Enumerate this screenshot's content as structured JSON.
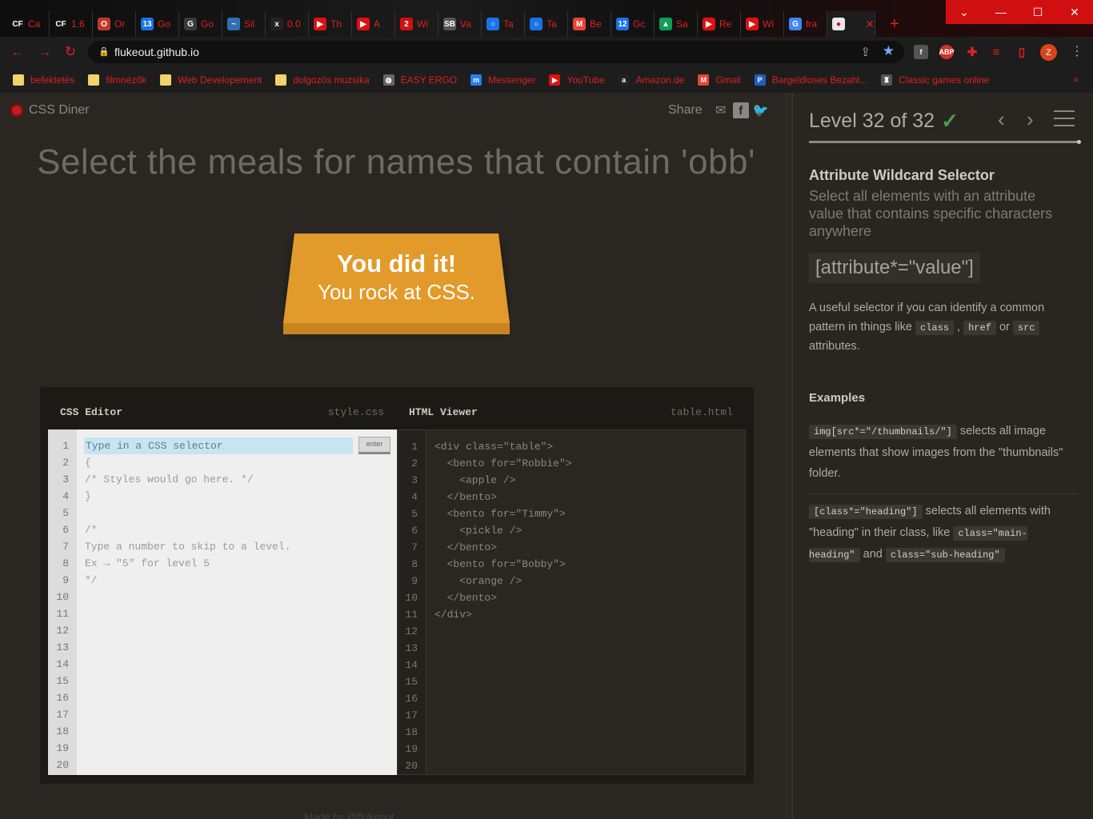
{
  "browser": {
    "tabs": [
      {
        "icon": "CF",
        "title": "Ca",
        "color": "#111111"
      },
      {
        "icon": "CF",
        "title": "1.6",
        "color": "#111111"
      },
      {
        "icon": "O",
        "title": "Or",
        "color": "#c0392b"
      },
      {
        "icon": "13",
        "title": "Go",
        "color": "#1a73e8"
      },
      {
        "icon": "G",
        "title": "Go",
        "color": "#3a3a3a"
      },
      {
        "icon": "~",
        "title": "Sil",
        "color": "#2f6fb3"
      },
      {
        "icon": "x",
        "title": "0.0",
        "color": "#222222"
      },
      {
        "icon": "▶",
        "title": "Th",
        "color": "#e01010"
      },
      {
        "icon": "▶",
        "title": "A ",
        "color": "#e01010"
      },
      {
        "icon": "2",
        "title": "Wi",
        "color": "#d01010"
      },
      {
        "icon": "SB",
        "title": "Va",
        "color": "#555555"
      },
      {
        "icon": "○",
        "title": "Ta",
        "color": "#1a73e8"
      },
      {
        "icon": "○",
        "title": "Ta",
        "color": "#1a73e8"
      },
      {
        "icon": "M",
        "title": "Be",
        "color": "#ea4335"
      },
      {
        "icon": "12",
        "title": "Gc",
        "color": "#1a73e8"
      },
      {
        "icon": "▲",
        "title": "Sa",
        "color": "#0f9d58"
      },
      {
        "icon": "▶",
        "title": "Re",
        "color": "#e01010"
      },
      {
        "icon": "▶",
        "title": "Wi",
        "color": "#e01010"
      },
      {
        "icon": "G",
        "title": "fra",
        "color": "#4285f4"
      },
      {
        "icon": "●",
        "title": "",
        "color": "#e8e8e8",
        "active": true
      }
    ],
    "url": "flukeout.github.io",
    "bookmarks": [
      {
        "label": "befektetés",
        "type": "folder"
      },
      {
        "label": "filmnézők",
        "type": "folder"
      },
      {
        "label": "Web Developement",
        "type": "folder"
      },
      {
        "label": "dolgozós muzsika",
        "type": "folder"
      },
      {
        "label": "EASY ERGO",
        "type": "globe"
      },
      {
        "label": "Messenger",
        "type": "messenger"
      },
      {
        "label": "YouTube",
        "type": "youtube"
      },
      {
        "label": "Amazon.de",
        "type": "amazon"
      },
      {
        "label": "Gmail",
        "type": "gmail"
      },
      {
        "label": "Bargeldloses Bezahl...",
        "type": "paypal"
      },
      {
        "label": "Classic games online",
        "type": "game"
      }
    ],
    "profile_initial": "Z"
  },
  "game": {
    "logo": "CSS Diner",
    "share_label": "Share",
    "instruction": "Select the meals for names that contain 'obb'",
    "win_line1": "You did it!",
    "win_line2": "You rock at CSS.",
    "css_editor": {
      "title": "CSS Editor",
      "file": "style.css",
      "placeholder": "Type in a CSS selector",
      "enter_label": "enter",
      "lines": [
        "",
        "{",
        "/* Styles would go here. */",
        "}",
        "",
        "/*",
        "Type a number to skip to a level.",
        "Ex → \"5\" for level 5",
        "*/"
      ]
    },
    "html_viewer": {
      "title": "HTML Viewer",
      "file": "table.html",
      "lines": [
        "<div class=\"table\">",
        "  <bento for=\"Robbie\">",
        "    <apple />",
        "  </bento>",
        "  <bento for=\"Timmy\">",
        "    <pickle />",
        "  </bento>",
        "  <bento for=\"Bobby\">",
        "    <orange />",
        "  </bento>",
        "</div>"
      ]
    },
    "line_count": 20,
    "footer": "Made by @flukeout"
  },
  "sidebar": {
    "level_text": "Level 32 of 32",
    "level_current": 32,
    "level_total": 32,
    "selector_name": "Attribute Wildcard Selector",
    "selector_desc": "Select all elements with an attribute value that contains specific characters anywhere",
    "syntax": "[attribute*=\"value\"]",
    "hint": {
      "t1": "A useful selector if you can identify a common pattern in things like ",
      "c1": "class",
      "t2": " , ",
      "c2": "href",
      "t3": " or ",
      "c3": "src",
      "t4": " attributes."
    },
    "examples_title": "Examples",
    "example1": {
      "code": "img[src*=\"/thumbnails/\"]",
      "text": " selects all image elements that show images from the \"thumbnails\" folder."
    },
    "example2": {
      "code": "[class*=\"heading\"]",
      "t1": " selects all elements with \"heading\" in their class, like ",
      "c2": "class=\"main-heading\"",
      "t2": " and ",
      "c3": "class=\"sub-heading\""
    }
  }
}
